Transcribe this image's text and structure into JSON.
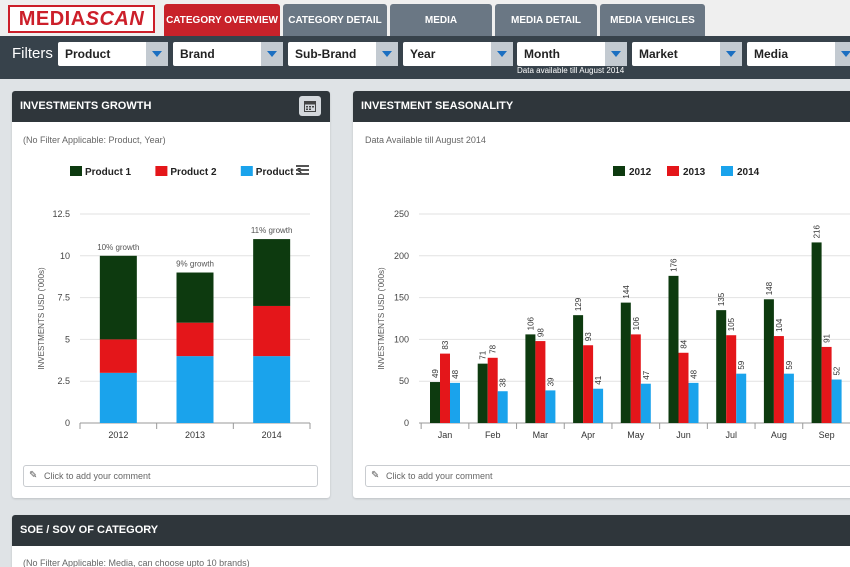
{
  "brand": {
    "logo_part1": "MEDIA",
    "logo_part2": "SCAN"
  },
  "tabs": [
    {
      "label": "CATEGORY OVERVIEW",
      "active": true
    },
    {
      "label": "CATEGORY DETAIL",
      "active": false
    },
    {
      "label": "MEDIA",
      "active": false
    },
    {
      "label": "MEDIA DETAIL",
      "active": false
    },
    {
      "label": "MEDIA VEHICLES",
      "active": false
    }
  ],
  "filters": {
    "label": "Filters",
    "selects": [
      {
        "label": "Product"
      },
      {
        "label": "Brand"
      },
      {
        "label": "Sub-Brand"
      },
      {
        "label": "Year"
      },
      {
        "label": "Month"
      },
      {
        "label": "Market"
      },
      {
        "label": "Media"
      }
    ],
    "note": "Data available till August 2014"
  },
  "growth_panel": {
    "title": "INVESTMENTS GROWTH",
    "subtitle": "(No Filter Applicable: Product, Year)",
    "comment_placeholder": "Click to add your comment",
    "icon": "calendar-icon"
  },
  "season_panel": {
    "title": "INVESTMENT SEASONALITY",
    "subtitle": "Data Available till August 2014",
    "comment_placeholder": "Click to add your comment"
  },
  "soe_panel": {
    "title": "SOE / SOV OF CATEGORY",
    "subtitle": "(No Filter Applicable: Media, can choose upto 10 brands)"
  },
  "colors": {
    "series1": "#0d3a0f",
    "series2": "#e4161a",
    "series3": "#1aa3ec",
    "accent": "#c8222a"
  },
  "chart_data": [
    {
      "type": "bar",
      "stacked": true,
      "categories": [
        "2012",
        "2013",
        "2014"
      ],
      "series": [
        {
          "name": "Product 1",
          "values": [
            5,
            3,
            4
          ]
        },
        {
          "name": "Product 2",
          "values": [
            2,
            2,
            3
          ]
        },
        {
          "name": "Product 3",
          "values": [
            3,
            4,
            4
          ]
        }
      ],
      "annotations": [
        "10% growth",
        "9% growth",
        "11% growth"
      ],
      "ylabel": "INVESTMENTS USD ('000s)",
      "ylim": [
        0,
        12.5
      ],
      "yticks": [
        "0",
        "2.5",
        "5",
        "7.5",
        "10",
        "12.5"
      ],
      "legend": "top-center"
    },
    {
      "type": "bar",
      "categories": [
        "Jan",
        "Feb",
        "Mar",
        "Apr",
        "May",
        "Jun",
        "Jul",
        "Aug",
        "Sep"
      ],
      "series": [
        {
          "name": "2012",
          "values": [
            49,
            71,
            106,
            129,
            144,
            176,
            135,
            148,
            216
          ]
        },
        {
          "name": "2013",
          "values": [
            83,
            78,
            98,
            93,
            106,
            84,
            105,
            104,
            91
          ]
        },
        {
          "name": "2014",
          "values": [
            48,
            38,
            39,
            41,
            47,
            48,
            59,
            59,
            52
          ]
        }
      ],
      "ylabel": "INVESTMENTS USD ('000s)",
      "ylim": [
        0,
        250
      ],
      "yticks": [
        "0",
        "50",
        "100",
        "150",
        "200",
        "250"
      ],
      "legend": "top-center"
    }
  ]
}
